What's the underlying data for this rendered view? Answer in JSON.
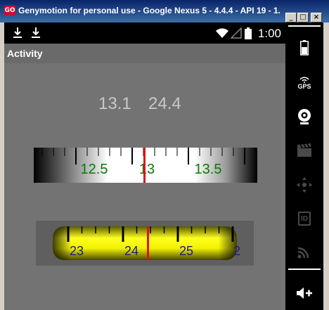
{
  "window": {
    "title": "Genymotion for personal use - Google Nexus 5 - 4.4.4 - API 19 - 1...",
    "app_icon_text": "GO",
    "minimize_glyph": "_",
    "maximize_glyph": "□",
    "close_glyph": "×"
  },
  "statusbar": {
    "time": "1:00"
  },
  "actionbar": {
    "title": "Activity"
  },
  "readouts": {
    "value_a": "13.1",
    "value_b": "24.4"
  },
  "gauge_top": {
    "labels": [
      "12.5",
      "13",
      "13.5"
    ],
    "label_color": "#0a7a0a",
    "needle_value": 13.1,
    "needle_color": "#e0101a"
  },
  "gauge_bottom": {
    "labels": [
      "23",
      "24",
      "25",
      "2"
    ],
    "label_color": "#1a1a8c",
    "tape_color": "#f2f200",
    "needle_value": 24.4,
    "needle_color": "#e0101a"
  },
  "nav": {
    "gps_label": "GPS",
    "id_label": "ID",
    "items": [
      "battery-icon",
      "gps-icon",
      "webcam-icon",
      "clapper-icon",
      "dpad-icon",
      "id-icon",
      "cast-icon",
      "volume-up-icon"
    ]
  }
}
